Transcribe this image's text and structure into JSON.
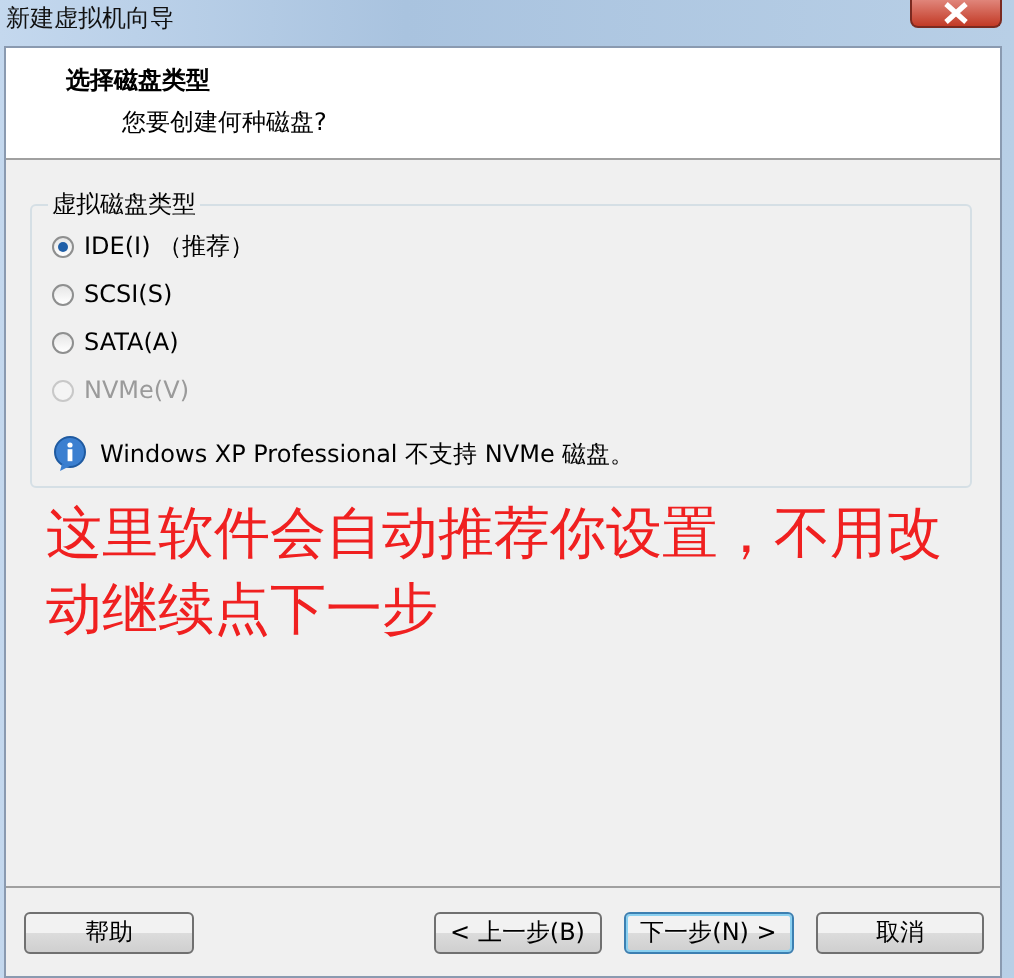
{
  "window": {
    "title": "新建虚拟机向导"
  },
  "header": {
    "title": "选择磁盘类型",
    "subtitle": "您要创建何种磁盘?"
  },
  "disk_type_group": {
    "legend": "虚拟磁盘类型",
    "options": [
      {
        "label": "IDE(I) （推荐）",
        "selected": true,
        "disabled": false
      },
      {
        "label": "SCSI(S)",
        "selected": false,
        "disabled": false
      },
      {
        "label": "SATA(A)",
        "selected": false,
        "disabled": false
      },
      {
        "label": "NVMe(V)",
        "selected": false,
        "disabled": true
      }
    ],
    "info": "Windows XP Professional 不支持 NVMe 磁盘。"
  },
  "annotation": "这里软件会自动推荐你设置，不用改动继续点下一步",
  "buttons": [
    {
      "label": "帮助",
      "kind": "help",
      "default": false
    },
    {
      "label": "< 上一步(B)",
      "kind": "back",
      "default": false
    },
    {
      "label": "下一步(N) >",
      "kind": "next",
      "default": true
    },
    {
      "label": "取消",
      "kind": "cancel",
      "default": false
    }
  ]
}
